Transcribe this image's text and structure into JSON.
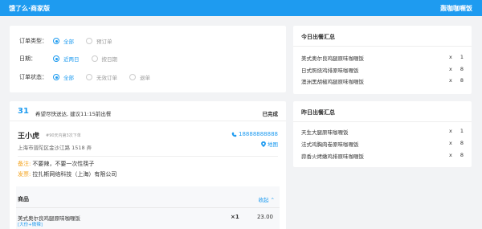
{
  "header": {
    "title": "饿了么·商家版",
    "shop_name": "轰咖咖喱饭"
  },
  "filters": {
    "order_type": {
      "label": "订单类型：",
      "options": [
        {
          "label": "全部",
          "active": true
        },
        {
          "label": "预订单",
          "active": false
        }
      ]
    },
    "date": {
      "label": "日期：",
      "options": [
        {
          "label": "近两日",
          "active": true
        },
        {
          "label": "按日期",
          "active": false
        }
      ]
    },
    "status": {
      "label": "订单状态：",
      "options": [
        {
          "label": "全部",
          "active": true
        },
        {
          "label": "无效订单",
          "active": false
        },
        {
          "label": "退单",
          "active": false
        }
      ]
    }
  },
  "today_summary": {
    "title": "今日出餐汇总",
    "items": [
      {
        "name": "美式奥尔良鸡腿原味咖喱饭",
        "x": "x",
        "qty": "1"
      },
      {
        "name": "日式照烧鸡排原味咖喱饭",
        "x": "x",
        "qty": "8"
      },
      {
        "name": "澳洲黑胡椒鸡腿原味咖喱饭",
        "x": "x",
        "qty": "8"
      }
    ]
  },
  "yesterday_summary": {
    "title": "昨日出餐汇总",
    "items": [
      {
        "name": "天生大腿原味咖喱饭",
        "x": "x",
        "qty": "1"
      },
      {
        "name": "法式鸡胸肉卷原味咖喱饭",
        "x": "x",
        "qty": "8"
      },
      {
        "name": "蒜香火烤嫩鸡排原味咖喱饭",
        "x": "x",
        "qty": "8"
      }
    ]
  },
  "order": {
    "number": "31",
    "hint": "希望尽快送达, 建议11:15前出餐",
    "status": "已完成",
    "customer": {
      "name": "王小虎",
      "note": "#90天内第3次下单",
      "address": "上海市普陀区金沙江路 1518 弄"
    },
    "phone": "18888888888",
    "map_label": "地图",
    "remark": {
      "key": "备注:",
      "value": "不要辣，不要一次性筷子"
    },
    "invoice": {
      "key": "发票:",
      "value": "拉扎斯网络科技（上海）有限公司"
    },
    "products": {
      "title": "商品",
      "collapse_label": "收起",
      "items": [
        {
          "name": "美式奥尔良鸡腿原味咖喱饭",
          "tag": "[大份+微辣]",
          "qty": "×1",
          "price": "23.00"
        }
      ]
    }
  },
  "colors": {
    "accent": "#1e9bf0",
    "remark": "#f5a623",
    "background": "#f2f3f5"
  }
}
